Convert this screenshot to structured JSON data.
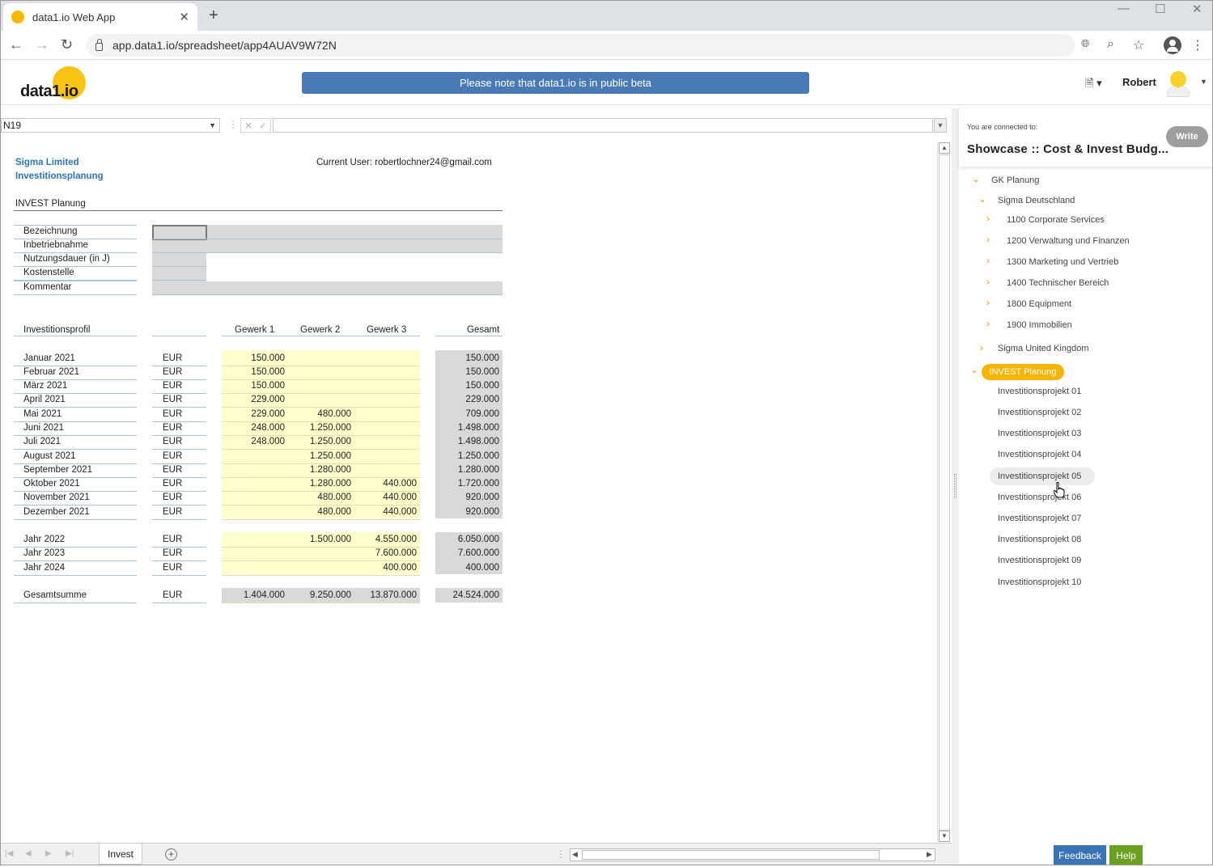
{
  "browser": {
    "tab_title": "data1.io Web App",
    "url": "app.data1.io/spreadsheet/app4AUAV9W72N"
  },
  "app": {
    "logo_text": "data1.io",
    "logo_mark": "io",
    "banner": "Please note that data1.io is in public beta",
    "user_name": "Robert"
  },
  "formula": {
    "cell_ref": "N19",
    "formula_text": ""
  },
  "sheet": {
    "company": "Sigma Limited",
    "subtitle": "Investitionsplanung",
    "current_user": "Current User: robertlochner24@gmail.com",
    "section": "INVEST Planung",
    "fields": [
      "Bezeichnung",
      "Inbetriebnahme",
      "Nutzungsdauer (in J)",
      "Kostenstelle",
      "Kommentar"
    ],
    "profile_header": "Investitionsprofil",
    "col_headers": [
      "Gewerk 1",
      "Gewerk 2",
      "Gewerk 3",
      "Gesamt"
    ],
    "rows": [
      {
        "label": "Januar 2021",
        "cur": "EUR",
        "g1": "150.000",
        "g2": "",
        "g3": "",
        "tot": "150.000"
      },
      {
        "label": "Februar 2021",
        "cur": "EUR",
        "g1": "150.000",
        "g2": "",
        "g3": "",
        "tot": "150.000"
      },
      {
        "label": "März 2021",
        "cur": "EUR",
        "g1": "150.000",
        "g2": "",
        "g3": "",
        "tot": "150.000"
      },
      {
        "label": "April 2021",
        "cur": "EUR",
        "g1": "229.000",
        "g2": "",
        "g3": "",
        "tot": "229.000"
      },
      {
        "label": "Mai 2021",
        "cur": "EUR",
        "g1": "229.000",
        "g2": "480.000",
        "g3": "",
        "tot": "709.000"
      },
      {
        "label": "Juni 2021",
        "cur": "EUR",
        "g1": "248.000",
        "g2": "1.250.000",
        "g3": "",
        "tot": "1.498.000"
      },
      {
        "label": "Juli 2021",
        "cur": "EUR",
        "g1": "248.000",
        "g2": "1.250.000",
        "g3": "",
        "tot": "1.498.000"
      },
      {
        "label": "August 2021",
        "cur": "EUR",
        "g1": "",
        "g2": "1.250.000",
        "g3": "",
        "tot": "1.250.000"
      },
      {
        "label": "September 2021",
        "cur": "EUR",
        "g1": "",
        "g2": "1.280.000",
        "g3": "",
        "tot": "1.280.000"
      },
      {
        "label": "Oktober 2021",
        "cur": "EUR",
        "g1": "",
        "g2": "1.280.000",
        "g3": "440.000",
        "tot": "1.720.000"
      },
      {
        "label": "November 2021",
        "cur": "EUR",
        "g1": "",
        "g2": "480.000",
        "g3": "440.000",
        "tot": "920.000"
      },
      {
        "label": "Dezember 2021",
        "cur": "EUR",
        "g1": "",
        "g2": "480.000",
        "g3": "440.000",
        "tot": "920.000"
      }
    ],
    "year_rows": [
      {
        "label": "Jahr 2022",
        "cur": "EUR",
        "g1": "",
        "g2": "1.500.000",
        "g3": "4.550.000",
        "tot": "6.050.000"
      },
      {
        "label": "Jahr 2023",
        "cur": "EUR",
        "g1": "",
        "g2": "",
        "g3": "7.600.000",
        "tot": "7.600.000"
      },
      {
        "label": "Jahr 2024",
        "cur": "EUR",
        "g1": "",
        "g2": "",
        "g3": "400.000",
        "tot": "400.000"
      }
    ],
    "total_row": {
      "label": "Gesamtsumme",
      "cur": "EUR",
      "g1": "1.404.000",
      "g2": "9.250.000",
      "g3": "13.870.000",
      "tot": "24.524.000"
    },
    "tab_name": "Invest"
  },
  "panel": {
    "connected_label": "You are connected to:",
    "connected_title": "Showcase :: Cost & Invest Budg...",
    "write_label": "Write",
    "tree": {
      "root": "GK Planung",
      "de": "Sigma Deutschland",
      "de_children": [
        "1100 Corporate Services",
        "1200 Verwaltung und Finanzen",
        "1300 Marketing und Vertrieb",
        "1400 Technischer Bereich",
        "1800 Equipment",
        "1900 Immobilien"
      ],
      "uk": "Sigma United Kingdom",
      "invest": "INVEST Planung",
      "projects": [
        "Investitionsprojekt 01",
        "Investitionsprojekt 02",
        "Investitionsprojekt 03",
        "Investitionsprojekt 04",
        "Investitionsprojekt 05",
        "Investitionsprojekt 06",
        "Investitionsprojekt 07",
        "Investitionsprojekt 08",
        "Investitionsprojekt 09",
        "Investitionsprojekt 10"
      ]
    },
    "feedback_label": "Feedback",
    "help_label": "Help"
  },
  "colors": {
    "accent": "#f7b500",
    "banner": "#4a7ab5",
    "company_text": "#2e75b6",
    "input_yellow": "#ffffcc",
    "calc_gray": "#d9d9d9"
  }
}
